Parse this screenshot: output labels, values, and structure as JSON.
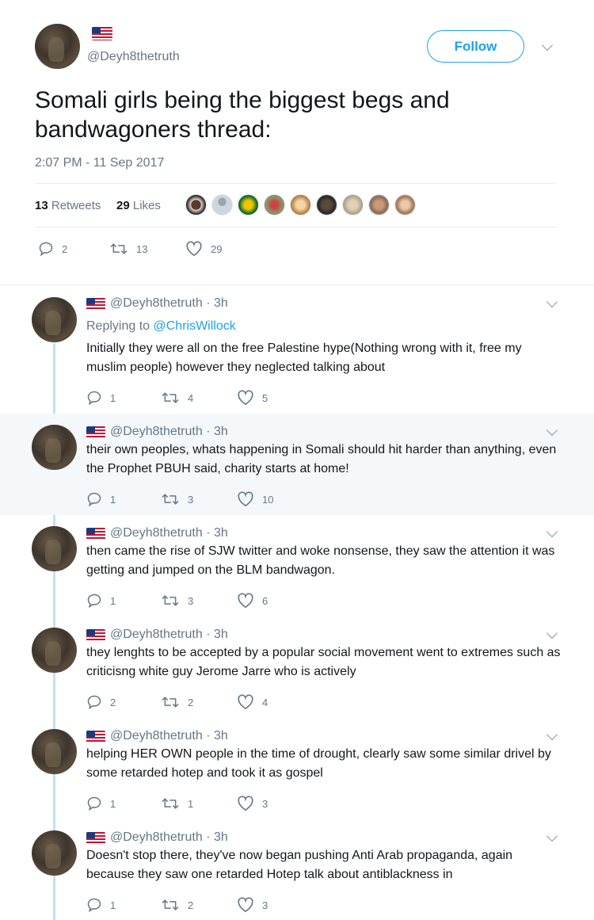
{
  "main_tweet": {
    "handle": "@Deyh8thetruth",
    "follow_label": "Follow",
    "text": "Somali girls being the biggest begs and bandwagoners thread:",
    "timestamp": "2:07 PM - 11 Sep 2017",
    "retweets_count": "13",
    "retweets_label": "Retweets",
    "likes_count": "29",
    "likes_label": "Likes",
    "actions": {
      "replies": "2",
      "retweets": "13",
      "likes": "29"
    }
  },
  "replies": [
    {
      "handle": "@Deyh8thetruth",
      "time": "3h",
      "replying_prefix": "Replying to",
      "replying_to": "@ChrisWillock",
      "text": "Initially they were all on the free Palestine hype(Nothing wrong with  it, free my muslim people) however they neglected talking about",
      "replies": "1",
      "retweets": "4",
      "likes": "5"
    },
    {
      "handle": "@Deyh8thetruth",
      "time": "3h",
      "text": "their own peoples, whats happening in Somali should hit harder than anything, even the Prophet PBUH said, charity starts at home!",
      "replies": "1",
      "retweets": "3",
      "likes": "10"
    },
    {
      "handle": "@Deyh8thetruth",
      "time": "3h",
      "text": "then came the rise of SJW twitter and woke nonsense, they saw the attention it was getting and jumped on the BLM bandwagon.",
      "replies": "1",
      "retweets": "3",
      "likes": "6"
    },
    {
      "handle": "@Deyh8thetruth",
      "time": "3h",
      "text": "they lenghts to be accepted by a popular social movement went to extremes such as criticisng white guy Jerome Jarre who is actively",
      "replies": "2",
      "retweets": "2",
      "likes": "4"
    },
    {
      "handle": "@Deyh8thetruth",
      "time": "3h",
      "text": "helping HER OWN people in the time of drought, clearly saw some similar drivel by some retarded hotep and took it as gospel",
      "replies": "1",
      "retweets": "1",
      "likes": "3"
    },
    {
      "handle": "@Deyh8thetruth",
      "time": "3h",
      "text": "Doesn't stop there, they've now began pushing Anti Arab propaganda, again because they saw one retarded Hotep talk about antiblackness in",
      "replies": "1",
      "retweets": "2",
      "likes": "3"
    }
  ],
  "colors": {
    "accent": "#1da1f2",
    "muted": "#657786",
    "text": "#14171a",
    "thread_line": "#bfe0f7",
    "shaded_bg": "#f5f8fa"
  },
  "icons": {
    "reply": "reply-icon",
    "retweet": "retweet-icon",
    "like": "heart-icon",
    "more": "chevron-down-icon",
    "flag": "us-flag-icon"
  }
}
